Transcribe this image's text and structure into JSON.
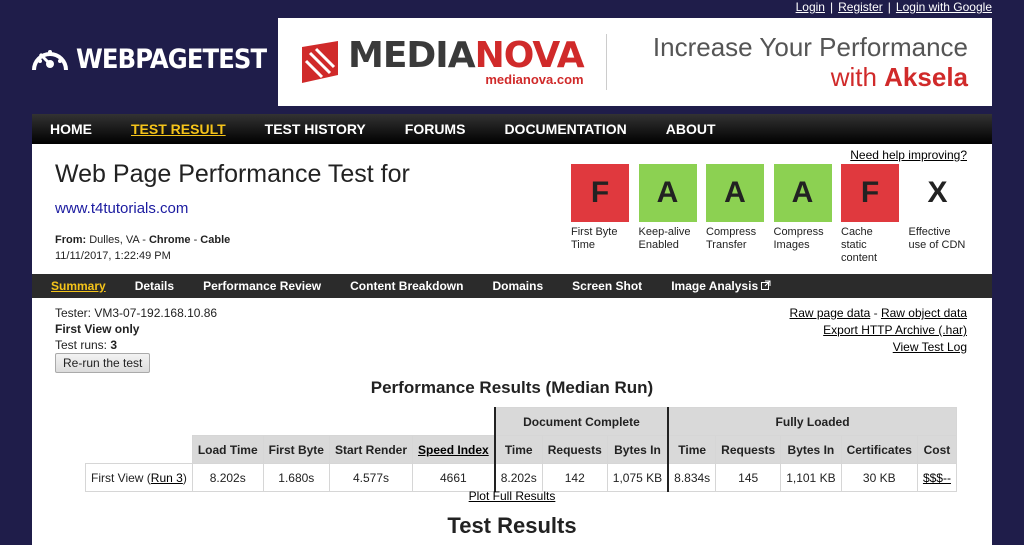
{
  "toplinks": {
    "login": "Login",
    "register": "Register",
    "login_google": "Login with Google",
    "sep": "|"
  },
  "logo": {
    "text": "WEBPAGETEST"
  },
  "banner": {
    "brand_a": "MEDIA",
    "brand_b": "NOVA",
    "domain": "medianova.com",
    "tag_line1": "Increase Your Performance",
    "tag_line2_pre": "with ",
    "tag_line2_bold": "Aksela",
    "colors": {
      "red": "#d02a2a"
    }
  },
  "nav": [
    "HOME",
    "TEST RESULT",
    "TEST HISTORY",
    "FORUMS",
    "DOCUMENTATION",
    "ABOUT"
  ],
  "nav_active": "TEST RESULT",
  "header": {
    "title": "Web Page Performance Test for",
    "url": "www.t4tutorials.com",
    "from_label": "From:",
    "from_location": "Dulles, VA",
    "dash": " - ",
    "browser": "Chrome",
    "connection": "Cable",
    "date": "11/11/2017, 1:22:49 PM",
    "help": "Need help improving?"
  },
  "grades": [
    {
      "grade": "F",
      "label": "First Byte Time",
      "color": "#e0393e"
    },
    {
      "grade": "A",
      "label": "Keep-alive Enabled",
      "color": "#8cd152"
    },
    {
      "grade": "A",
      "label": "Compress Transfer",
      "color": "#8cd152"
    },
    {
      "grade": "A",
      "label": "Compress Images",
      "color": "#8cd152"
    },
    {
      "grade": "F",
      "label": "Cache static content",
      "color": "#e0393e"
    },
    {
      "grade": "X",
      "label": "Effective use of CDN",
      "color": "#ffffff"
    }
  ],
  "subnav": [
    "Summary",
    "Details",
    "Performance Review",
    "Content Breakdown",
    "Domains",
    "Screen Shot",
    "Image Analysis"
  ],
  "subnav_active": "Summary",
  "tester": {
    "tester": "Tester: VM3-07-192.168.10.86",
    "view": "First View only",
    "runs_label": "Test runs: ",
    "runs": "3",
    "rerun": "Re-run the test"
  },
  "links": {
    "raw_page": "Raw page data",
    "dash": " - ",
    "raw_object": "Raw object data",
    "export": "Export HTTP Archive (.har)",
    "log": "View Test Log"
  },
  "results": {
    "title": "Performance Results (Median Run)",
    "group_doc": "Document Complete",
    "group_full": "Fully Loaded",
    "headers": [
      "Load Time",
      "First Byte",
      "Start Render",
      "Speed Index",
      "Time",
      "Requests",
      "Bytes In",
      "Time",
      "Requests",
      "Bytes In",
      "Certificates",
      "Cost"
    ],
    "row_label": "First View (",
    "row_run": "Run 3",
    "row_close": ")",
    "values": [
      "8.202s",
      "1.680s",
      "4.577s",
      "4661",
      "8.202s",
      "142",
      "1,075 KB",
      "8.834s",
      "145",
      "1,101 KB",
      "30 KB",
      "$$$--"
    ],
    "plot": "Plot Full Results"
  },
  "test_results": "Test Results"
}
